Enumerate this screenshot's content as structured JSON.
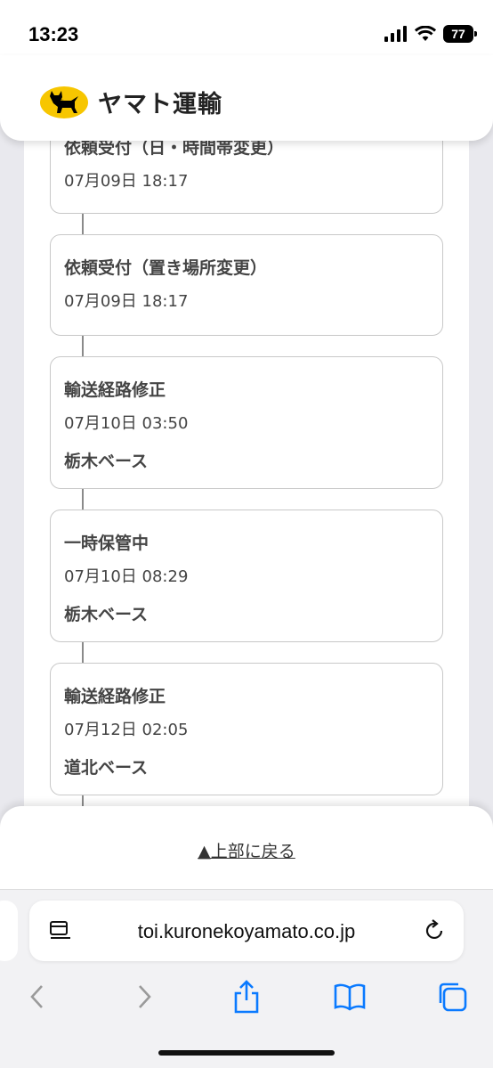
{
  "status_bar": {
    "time": "13:23",
    "battery": "77"
  },
  "header": {
    "logo_text": "ヤマト運輸"
  },
  "events": [
    {
      "title": "依頼受付（日・時間帯変更）",
      "datetime": "07月09日 18:17",
      "place": ""
    },
    {
      "title": "依頼受付（置き場所変更）",
      "datetime": "07月09日 18:17",
      "place": ""
    },
    {
      "title": "輸送経路修正",
      "datetime": "07月10日 03:50",
      "place": "栃木ベース"
    },
    {
      "title": "一時保管中",
      "datetime": "07月10日 08:29",
      "place": "栃木ベース"
    },
    {
      "title": "輸送経路修正",
      "datetime": "07月12日 02:05",
      "place": "道北ベース"
    }
  ],
  "back_to_top": "▲上部に戻る",
  "browser": {
    "url": "toi.kuronekoyamato.co.jp",
    "icons": {
      "page_menu": "page-format-icon",
      "reload": "reload-icon",
      "back": "chevron-left-icon",
      "forward": "chevron-right-icon",
      "share": "share-icon",
      "bookmarks": "book-icon",
      "tabs": "tabs-icon"
    }
  },
  "colors": {
    "accent_blue": "#0a7aff",
    "logo_yellow": "#f7c600",
    "text": "#444444"
  }
}
